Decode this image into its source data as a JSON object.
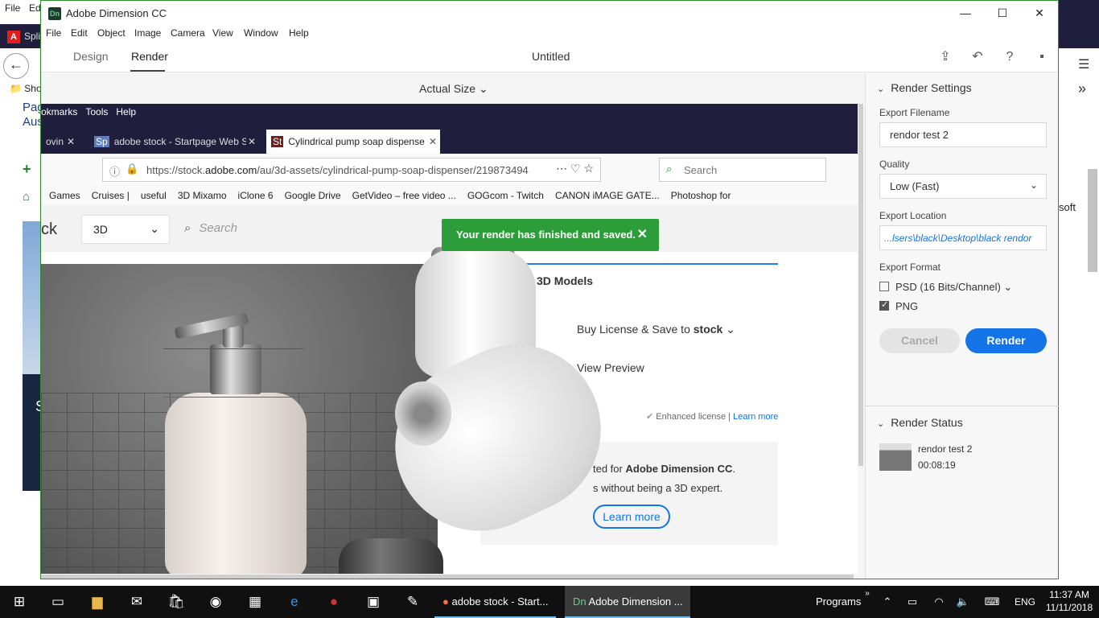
{
  "background": {
    "menu": [
      "File",
      "Ed"
    ],
    "tab_label": "Spli",
    "bookmark_label": "Sho",
    "page_text": [
      "Pag",
      "Aus"
    ],
    "dark_text": "S",
    "right_text": "soft"
  },
  "window": {
    "title": "Adobe Dimension CC",
    "icon_label": "Dn",
    "controls": {
      "minimize": "—",
      "maximize": "☐",
      "close": "✕"
    }
  },
  "menubar": [
    "File",
    "Edit",
    "Object",
    "Image",
    "Camera",
    "View",
    "Window",
    "Help"
  ],
  "modes": {
    "design": "Design",
    "render": "Render"
  },
  "document_title": "Untitled",
  "toolbar_icons": [
    "share-icon",
    "undo-icon",
    "help-icon",
    "feedback-icon"
  ],
  "view": {
    "zoom": "Actual Size"
  },
  "toast": {
    "message": "Your render has finished and saved.",
    "close": "✕"
  },
  "embedded_browser": {
    "menu": [
      "okmarks",
      "Tools",
      "Help"
    ],
    "tabs": [
      "ovin",
      "adobe stock - Startpage Web S",
      "Cylindrical pump soap dispense"
    ],
    "tab_close": "✕",
    "url_prefix": "https://stock.",
    "url_domain": "adobe.com",
    "url_path": "/au/3d-assets/cylindrical-pump-soap-dispenser/219873494",
    "search_placeholder": "Search",
    "bookmarks": [
      "Games",
      "Cruises |",
      "useful",
      "3D Mixamo",
      "iClone 6",
      "Google Drive",
      "GetVideo – free video ...",
      "GOGcom - Twitch",
      "CANON iMAGE GATE...",
      "Photoshop for"
    ],
    "stock_logo": "ck",
    "category": "3D",
    "stock_search": "Search",
    "card_title": "3D Models",
    "buy_prefix": "Buy License & Save to",
    "buy_target": "stock",
    "view_preview": "View Preview",
    "enhanced_text": "Enhanced license |",
    "enhanced_link": "Learn more",
    "promo_prefix": "ted for",
    "promo_app": "Adobe Dimension CC",
    "promo_line2": "s without being a 3D expert.",
    "promo_button": "Learn more"
  },
  "render_settings": {
    "title": "Render Settings",
    "export_filename_label": "Export Filename",
    "export_filename": "rendor test 2",
    "quality_label": "Quality",
    "quality": "Low (Fast)",
    "export_location_label": "Export Location",
    "export_location": "...lsers\\black\\Desktop\\black rendor",
    "export_format_label": "Export Format",
    "formats": [
      {
        "label": "PSD (16 Bits/Channel)",
        "checked": false
      },
      {
        "label": "PNG",
        "checked": true
      }
    ],
    "cancel": "Cancel",
    "render": "Render"
  },
  "render_status": {
    "title": "Render Status",
    "item_name": "rendor test 2",
    "item_time": "00:08:19"
  },
  "taskbar": {
    "firefox_label": "adobe stock - Start...",
    "dimension_label": "Adobe Dimension ...",
    "programs": "Programs",
    "language": "ENG",
    "time": "11:37 AM",
    "date": "11/11/2018"
  },
  "colors": {
    "accent": "#1473e6",
    "toast": "#2d9d3a",
    "window_border": "#2e8b2e",
    "taskbar": "#101010"
  }
}
